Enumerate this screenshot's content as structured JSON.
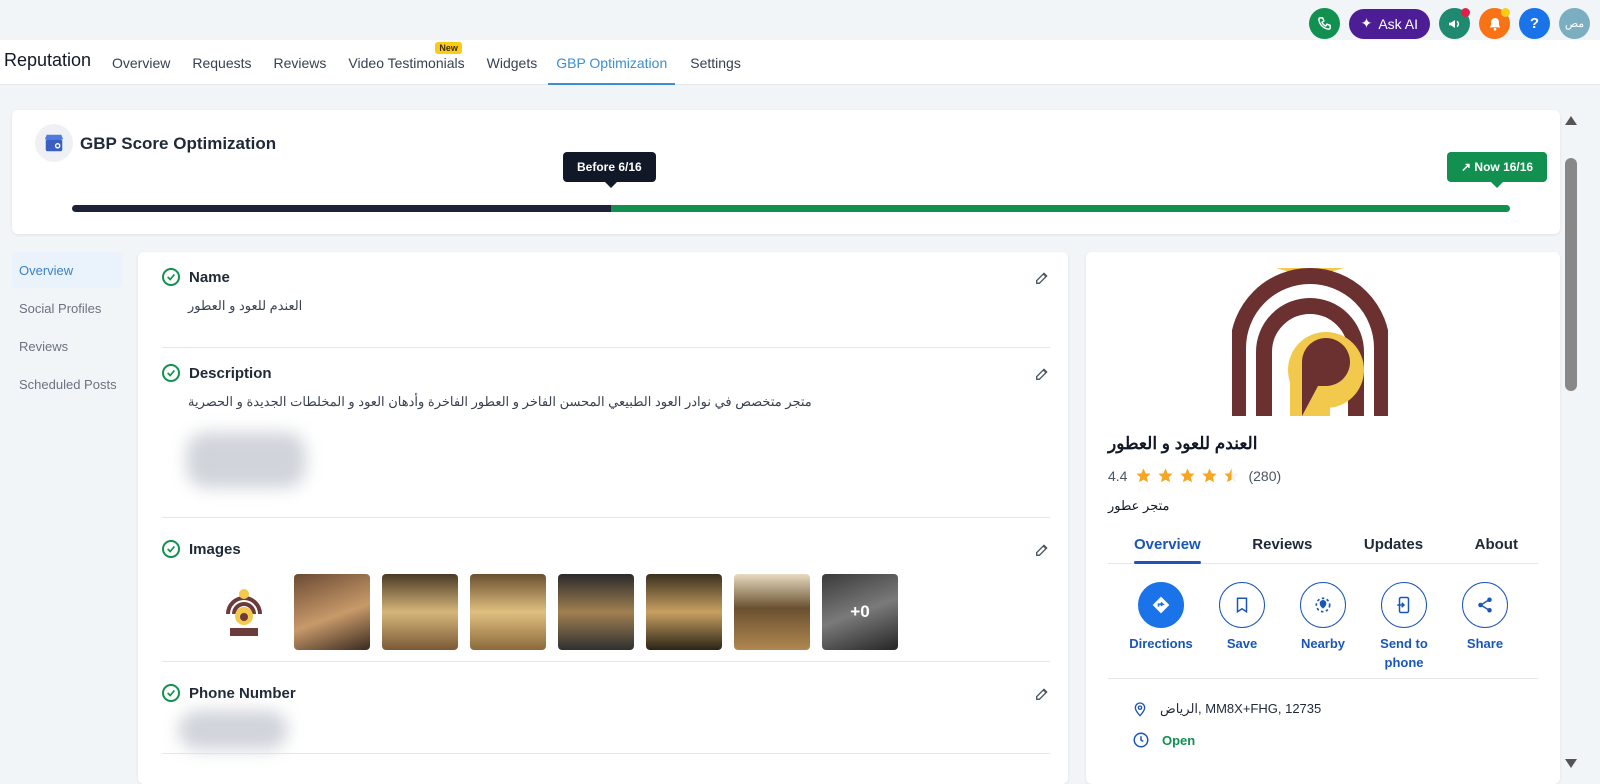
{
  "header": {
    "ask_ai_label": "Ask AI",
    "avatar_text": "مص",
    "help_label": "?"
  },
  "nav": {
    "brand": "Reputation",
    "tabs": [
      {
        "label": "Overview"
      },
      {
        "label": "Requests"
      },
      {
        "label": "Reviews"
      },
      {
        "label": "Video Testimonials",
        "badge": "New"
      },
      {
        "label": "Widgets"
      },
      {
        "label": "GBP Optimization",
        "active": true
      },
      {
        "label": "Settings"
      }
    ]
  },
  "score": {
    "title": "GBP Score Optimization",
    "before_label": "Before 6/16",
    "now_label": "Now 16/16",
    "before_value": 6,
    "now_value": 16,
    "max": 16
  },
  "sidebar": {
    "items": [
      {
        "label": "Overview",
        "active": true
      },
      {
        "label": "Social Profiles"
      },
      {
        "label": "Reviews"
      },
      {
        "label": "Scheduled Posts"
      }
    ]
  },
  "main": {
    "name": {
      "label": "Name",
      "value": "العندم للعود و العطور"
    },
    "description": {
      "label": "Description",
      "value": "متجر متخصص في نوادر العود الطبيعي المحسن الفاخر و العطور الفاخرة وأدهان العود و المخلطات الجديدة و الحصرية"
    },
    "images": {
      "label": "Images",
      "more_label": "+0"
    },
    "phone": {
      "label": "Phone Number"
    }
  },
  "profile": {
    "name": "العندم للعود و العطور",
    "rating": "4.4",
    "rating_value": 4.4,
    "reviews_count": "(280)",
    "category": "متجر عطور",
    "tabs": [
      {
        "label": "Overview",
        "active": true
      },
      {
        "label": "Reviews"
      },
      {
        "label": "Updates"
      },
      {
        "label": "About"
      }
    ],
    "actions": [
      {
        "label": "Directions",
        "icon": "directions-icon"
      },
      {
        "label": "Save",
        "icon": "bookmark-icon"
      },
      {
        "label": "Nearby",
        "icon": "nearby-icon"
      },
      {
        "label": "Send to phone",
        "icon": "send-to-phone-icon"
      },
      {
        "label": "Share",
        "icon": "share-icon"
      }
    ],
    "address": "الرياض, MM8X+FHG, 12735",
    "status": "Open"
  },
  "colors": {
    "accent": "#3b8fd0",
    "green": "#11904f",
    "dark_bar": "#1e2238",
    "maps_blue": "#1a56b8"
  }
}
